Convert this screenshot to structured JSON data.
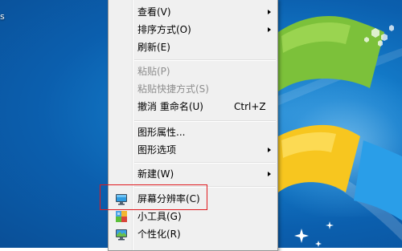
{
  "desktop": {
    "icon_label": "s"
  },
  "context_menu": {
    "items": [
      {
        "label": "查看(V)",
        "submenu": true
      },
      {
        "label": "排序方式(O)",
        "submenu": true
      },
      {
        "label": "刷新(E)"
      },
      {
        "label": "粘贴(P)",
        "disabled": true
      },
      {
        "label": "粘贴快捷方式(S)",
        "disabled": true
      },
      {
        "label": "撤消 重命名(U)",
        "shortcut": "Ctrl+Z"
      },
      {
        "label": "图形属性..."
      },
      {
        "label": "图形选项",
        "submenu": true
      },
      {
        "label": "新建(W)",
        "submenu": true
      },
      {
        "label": "屏幕分辨率(C)",
        "icon": "monitor-icon",
        "highlighted": true
      },
      {
        "label": "小工具(G)",
        "icon": "gadgets-icon"
      },
      {
        "label": "个性化(R)",
        "icon": "personalize-icon"
      }
    ]
  },
  "colors": {
    "highlight_border": "#e0191e",
    "menu_background": "#f0f0f0",
    "desktop_blue": "#0b5fae"
  }
}
